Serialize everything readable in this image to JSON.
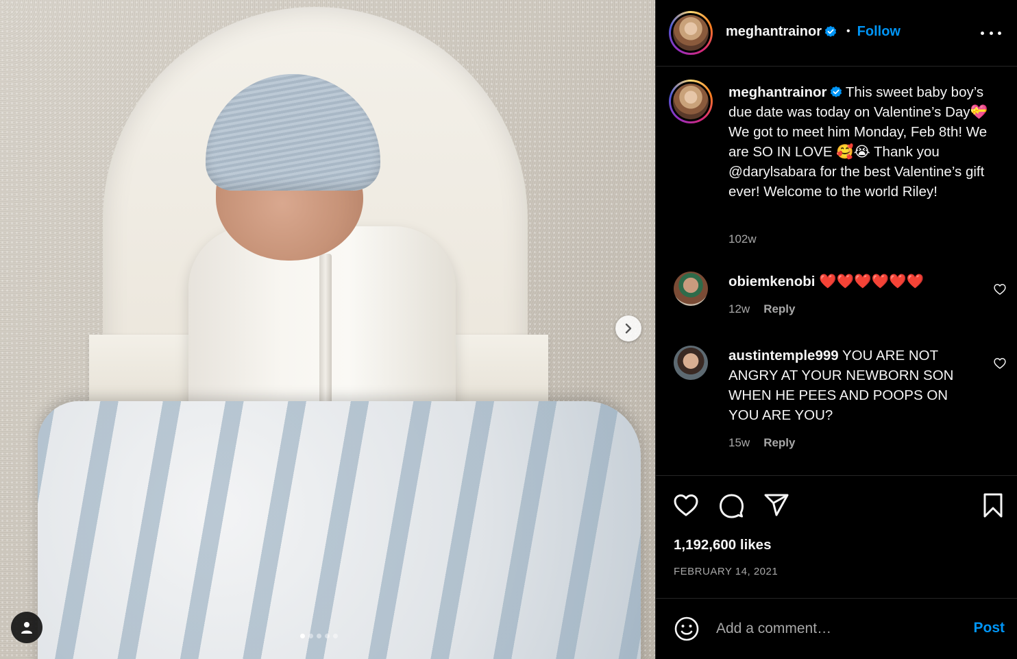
{
  "post": {
    "carousel": {
      "dots_total": 5,
      "active_index": 0,
      "next_icon": "chevron-right-icon",
      "tag_icon": "user-tag-icon"
    },
    "header": {
      "username": "meghantrainor",
      "separator": "•",
      "follow_label": "Follow",
      "more_icon": "more-horizontal-icon"
    },
    "caption": {
      "username": "meghantrainor",
      "text": "This sweet baby boy’s due date was today on Valentine’s Day💝 We got to meet him Monday, Feb 8th! We are SO IN LOVE 🥰😭 Thank you @darylsabara for the best Valentine’s gift ever! Welcome to the world Riley!",
      "age": "102w"
    },
    "comments": [
      {
        "username": "obiemkenobi",
        "text": "❤️❤️❤️❤️❤️❤️",
        "age": "12w",
        "reply_label": "Reply"
      },
      {
        "username": "austintemple999",
        "text": "YOU ARE NOT ANGRY AT YOUR NEWBORN SON WHEN HE PEES AND POOPS ON YOU ARE YOU?",
        "age": "15w",
        "reply_label": "Reply"
      }
    ],
    "likes": "1,192,600 likes",
    "date": "FEBRUARY 14, 2021",
    "add_comment": {
      "placeholder": "Add a comment…",
      "post_label": "Post"
    }
  },
  "colors": {
    "background": "#000000",
    "accent_blue": "#0095f6",
    "secondary_text": "#a8a8a8",
    "divider": "#262626"
  }
}
